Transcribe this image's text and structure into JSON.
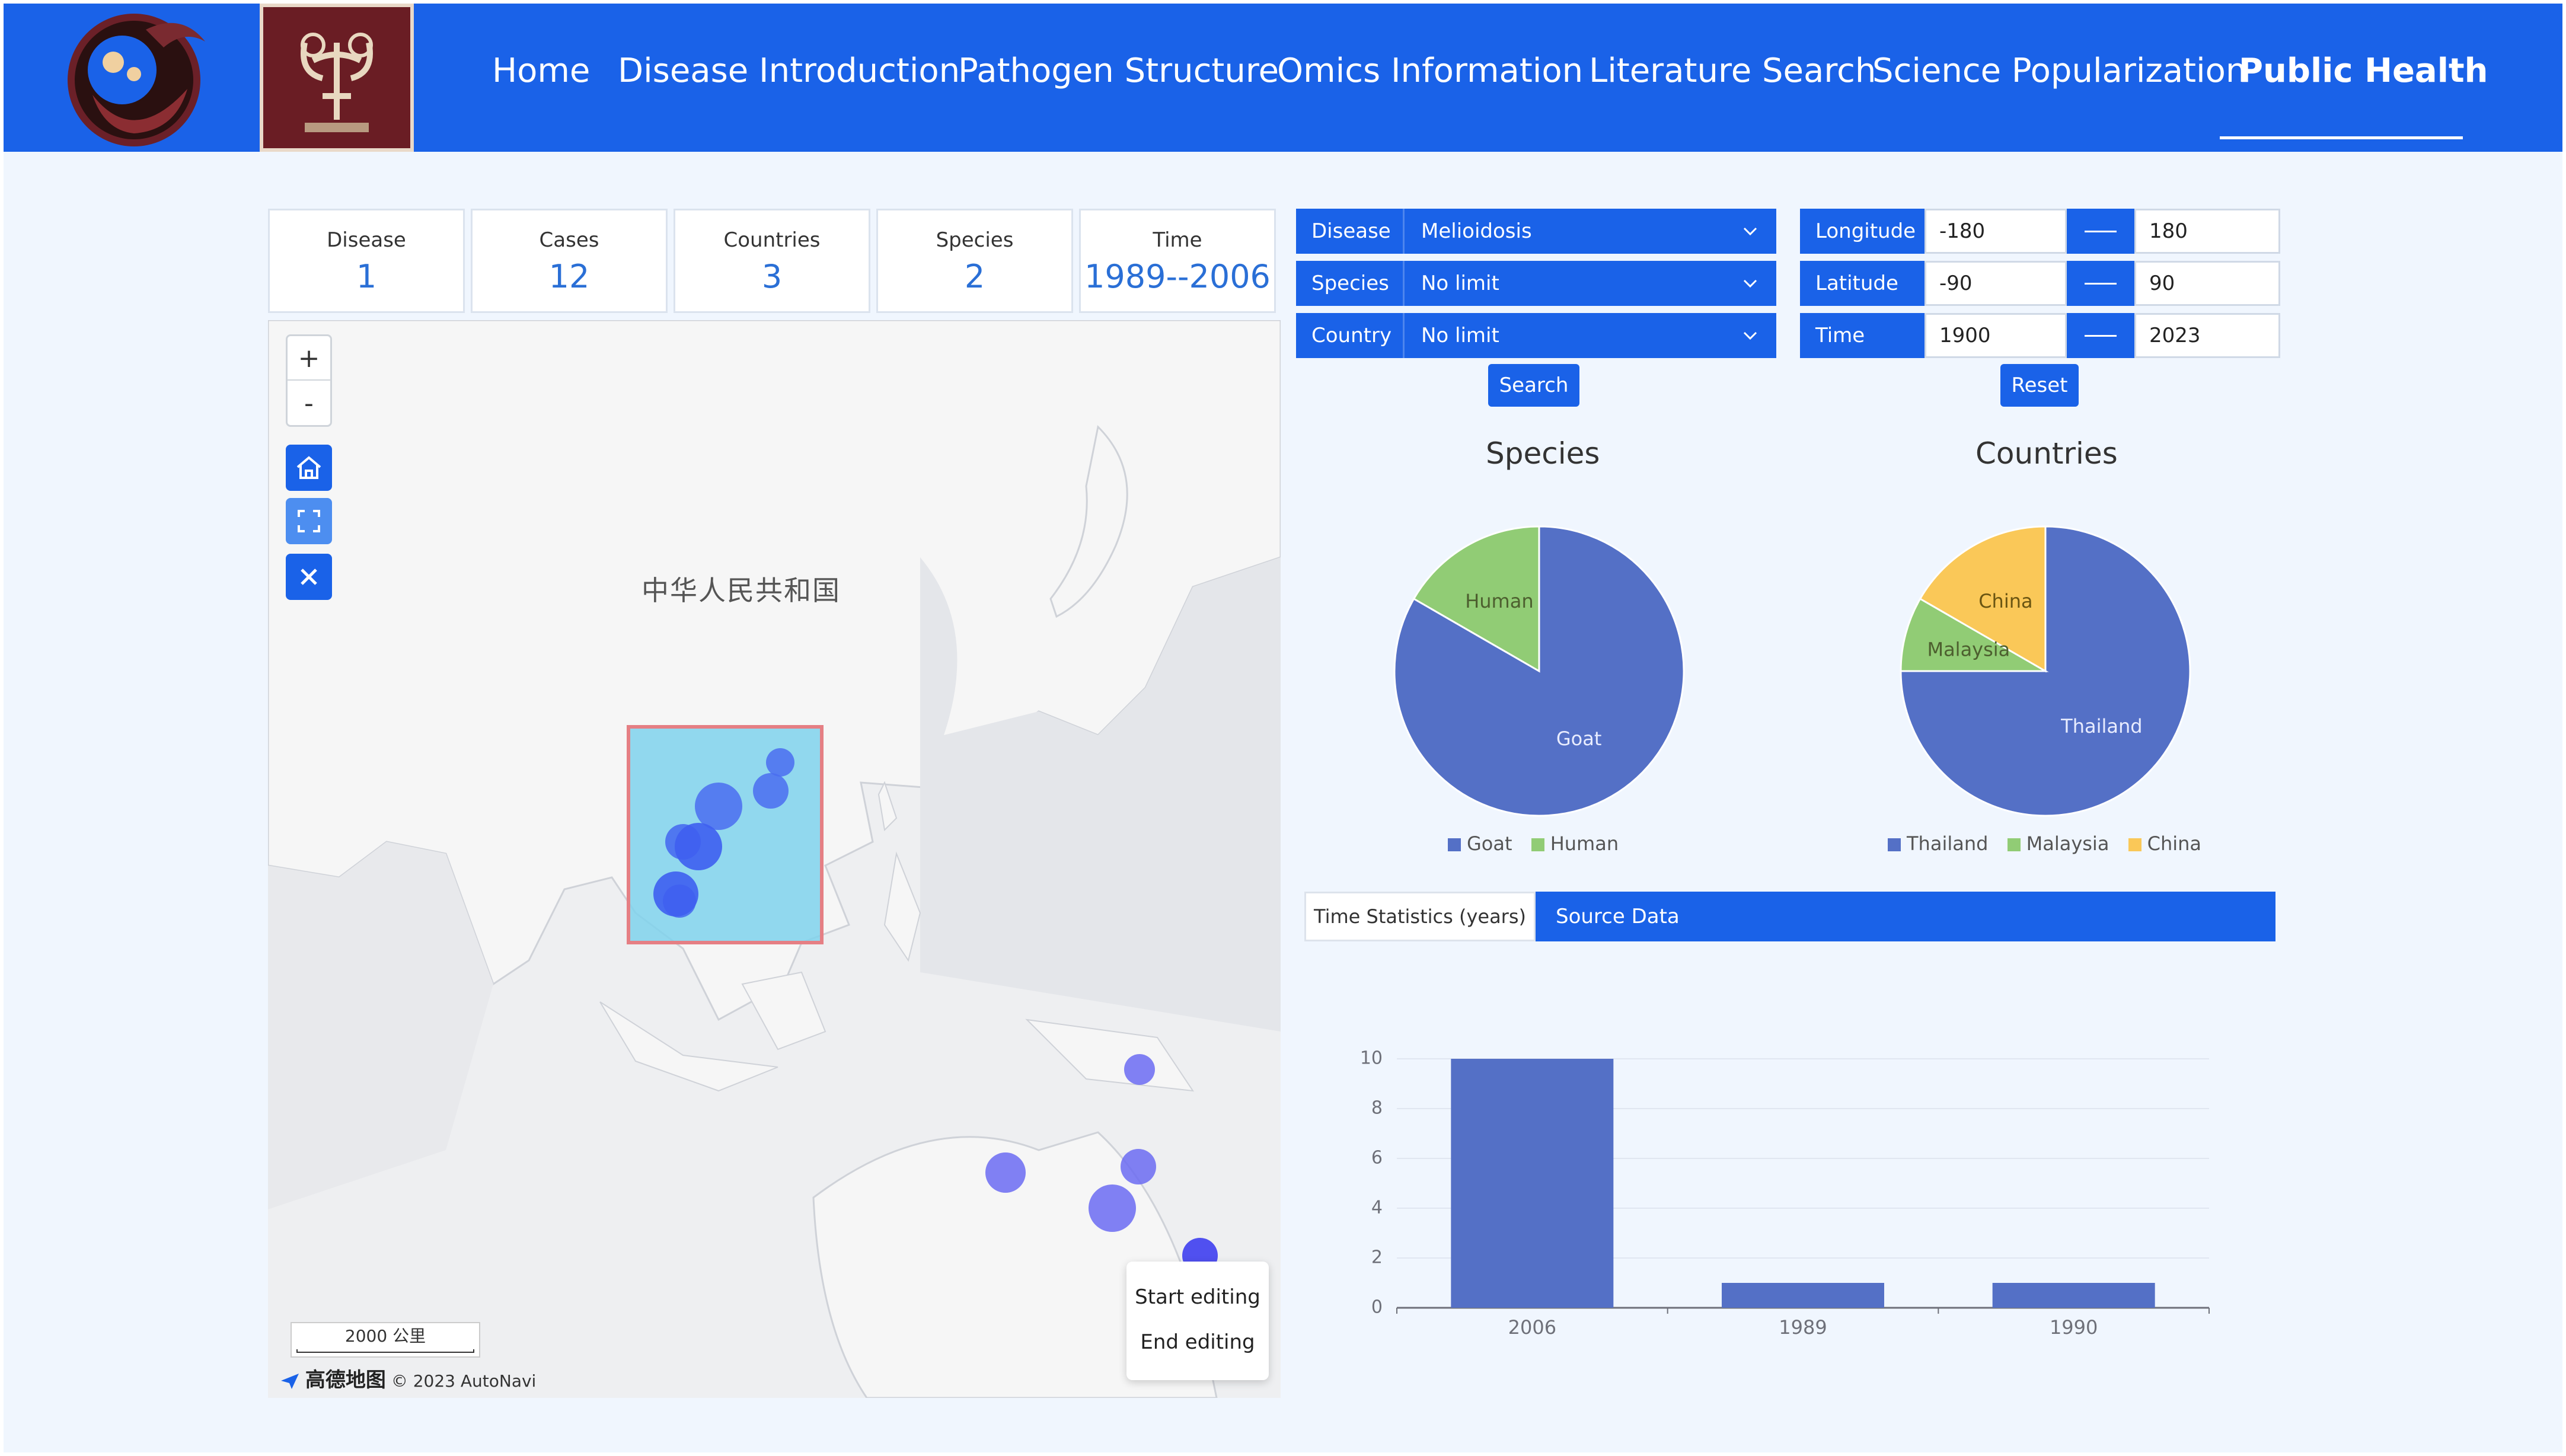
{
  "nav": {
    "items": [
      {
        "label": "Home"
      },
      {
        "label": "Disease Introduction"
      },
      {
        "label": "Pathogen Structure"
      },
      {
        "label": "Omics Information"
      },
      {
        "label": "Literature Search"
      },
      {
        "label": "Science Popularization"
      },
      {
        "label": "Public Health",
        "active": true
      }
    ]
  },
  "stats": [
    {
      "label": "Disease",
      "value": "1"
    },
    {
      "label": "Cases",
      "value": "12"
    },
    {
      "label": "Countries",
      "value": "3"
    },
    {
      "label": "Species",
      "value": "2"
    },
    {
      "label": "Time",
      "value": "1989--2006"
    }
  ],
  "map": {
    "zoom_in": "+",
    "zoom_out": "-",
    "country_label": "中华人民共和国",
    "scale": "2000 公里",
    "brand": "高德地图",
    "copyright": "© 2023 AutoNavi",
    "edit_start": "Start editing",
    "edit_end": "End editing"
  },
  "filters": {
    "disease_label": "Disease",
    "disease_value": "Melioidosis",
    "species_label": "Species",
    "species_value": "No limit",
    "country_label": "Country",
    "country_value": "No limit",
    "longitude_label": "Longitude",
    "longitude_min": "-180",
    "longitude_max": "180",
    "latitude_label": "Latitude",
    "latitude_min": "-90",
    "latitude_max": "90",
    "time_label": "Time",
    "time_min": "1900",
    "time_max": "2023",
    "search_button": "Search",
    "reset_button": "Reset"
  },
  "tabs": {
    "time": "Time Statistics (years)",
    "source": "Source Data"
  },
  "colors": {
    "primary": "#1a62e8",
    "blue": "#5470c6",
    "green": "#91cc75",
    "yellow": "#fac858"
  },
  "chart_data": [
    {
      "type": "pie",
      "title": "Species",
      "labels": [
        "Goat",
        "Human"
      ],
      "values": [
        10,
        2
      ],
      "colors": [
        "#5470c6",
        "#91cc75"
      ]
    },
    {
      "type": "pie",
      "title": "Countries",
      "labels": [
        "Thailand",
        "Malaysia",
        "China"
      ],
      "values": [
        9,
        1,
        2
      ],
      "colors": [
        "#5470c6",
        "#91cc75",
        "#fac858"
      ]
    },
    {
      "type": "bar",
      "categories": [
        "2006",
        "1989",
        "1990"
      ],
      "values": [
        10,
        1,
        1
      ],
      "ylim": [
        0,
        10
      ],
      "yticks": [
        0,
        2,
        4,
        6,
        8,
        10
      ],
      "color": "#5470c6"
    }
  ]
}
